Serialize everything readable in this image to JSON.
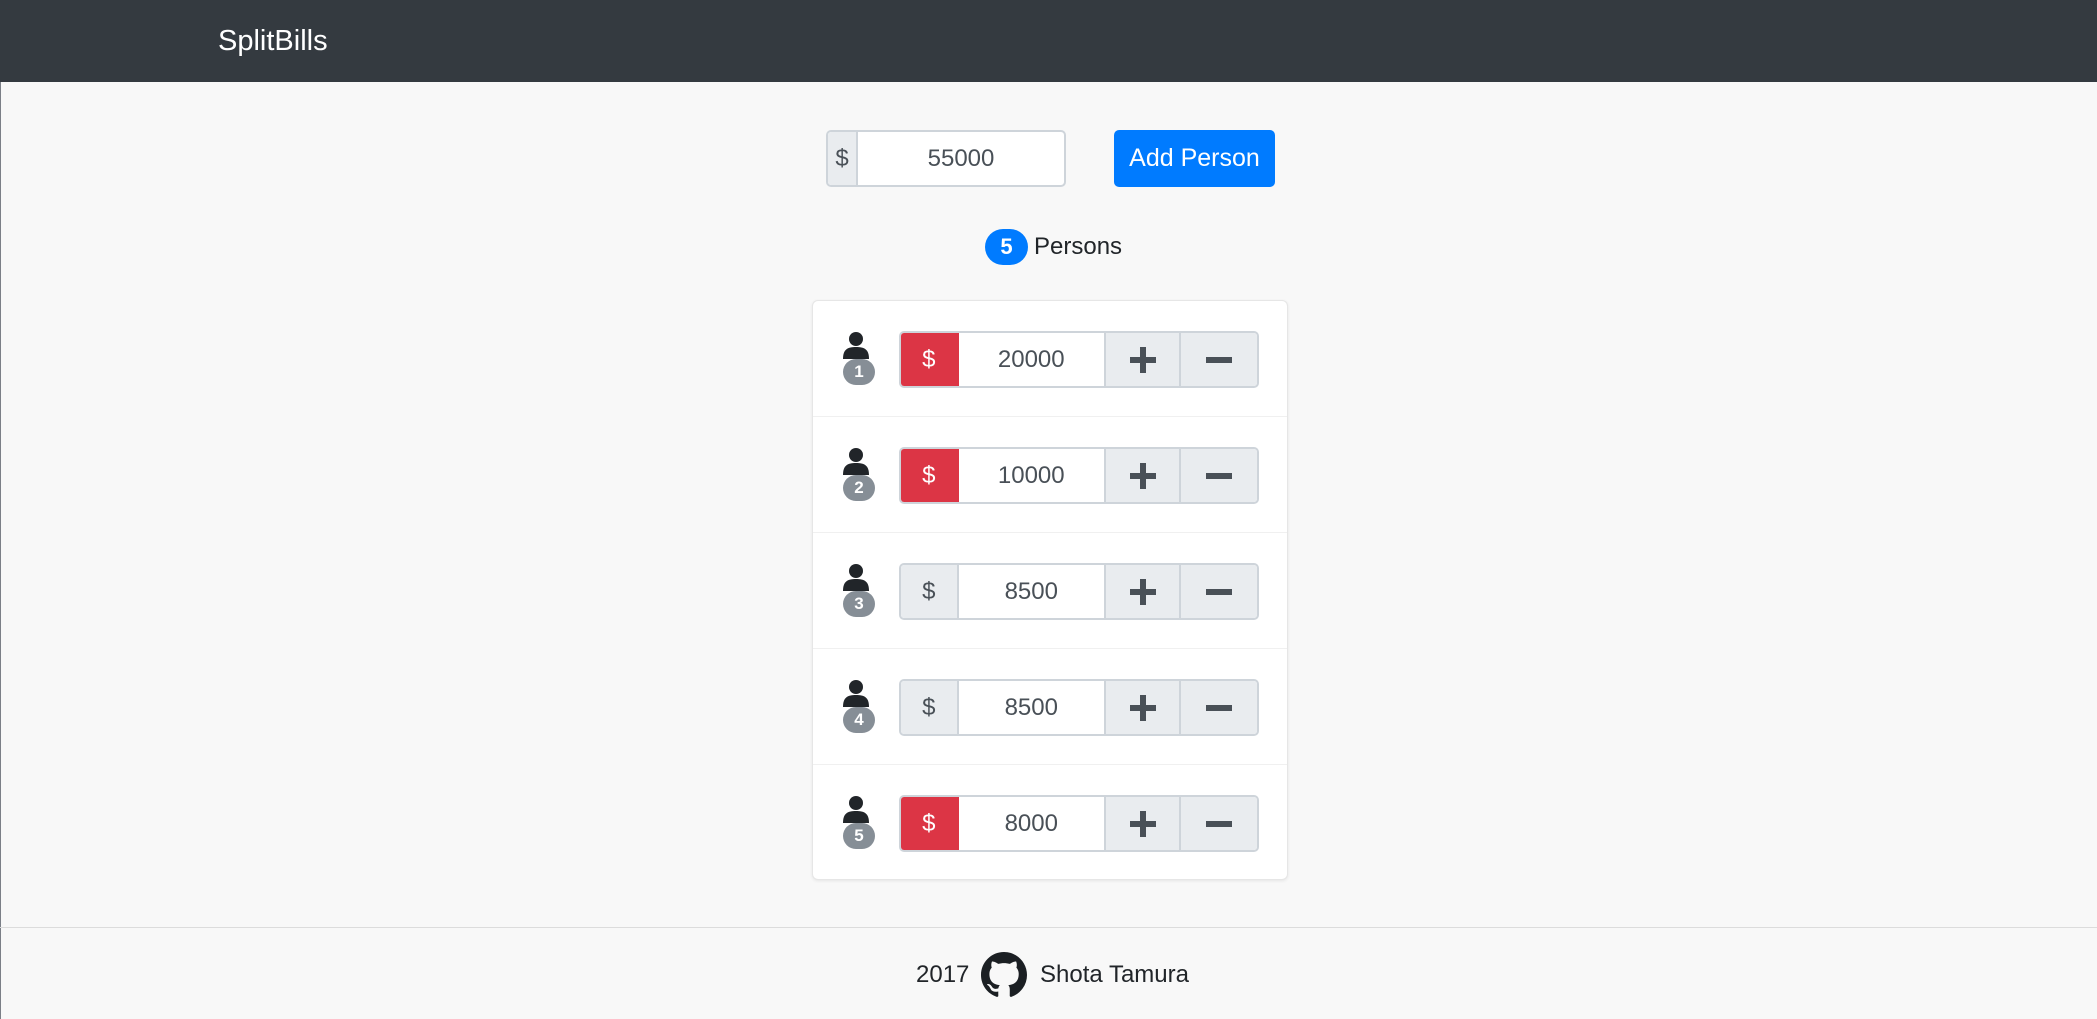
{
  "app": {
    "brand": "SplitBills"
  },
  "total": {
    "currency_symbol": "$",
    "value": "55000"
  },
  "add_person_button": "Add Person",
  "persons": {
    "count": "5",
    "label": "Persons"
  },
  "colors": {
    "primary": "#007bff",
    "danger": "#dc3545",
    "navbar": "#343a40"
  },
  "rows": [
    {
      "number": "1",
      "currency_symbol": "$",
      "amount": "20000",
      "highlight": "danger"
    },
    {
      "number": "2",
      "currency_symbol": "$",
      "amount": "10000",
      "highlight": "danger"
    },
    {
      "number": "3",
      "currency_symbol": "$",
      "amount": "8500",
      "highlight": "neutral"
    },
    {
      "number": "4",
      "currency_symbol": "$",
      "amount": "8500",
      "highlight": "neutral"
    },
    {
      "number": "5",
      "currency_symbol": "$",
      "amount": "8000",
      "highlight": "danger"
    }
  ],
  "icons": {
    "person": "user-icon",
    "plus": "plus-icon",
    "minus": "minus-icon",
    "github": "github-icon"
  },
  "footer": {
    "year": "2017",
    "author": "Shota Tamura"
  }
}
